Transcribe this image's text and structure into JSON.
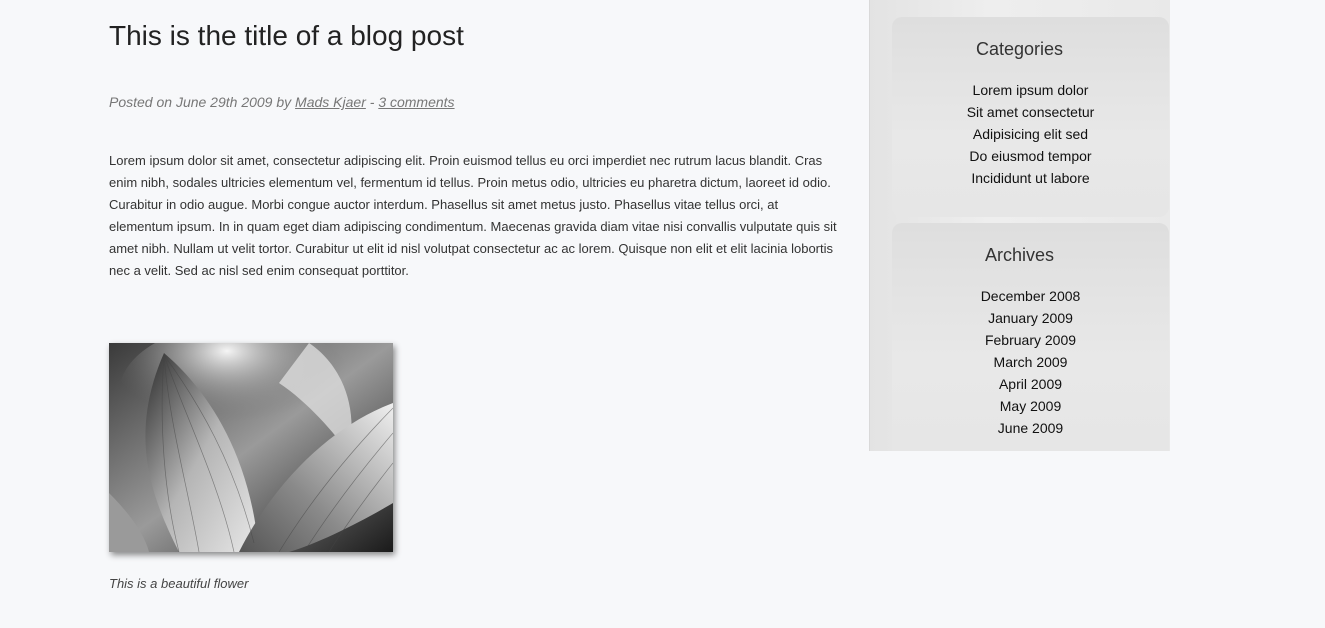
{
  "post": {
    "title": "This is the title of a blog post",
    "meta_prefix": "Posted on June 29th 2009 by",
    "author": "Mads Kjaer",
    "separator": "-",
    "comments": "3 comments",
    "body": "Lorem ipsum dolor sit amet, consectetur adipiscing elit. Proin euismod tellus eu orci imperdiet nec rutrum lacus blandit. Cras enim nibh, sodales ultricies elementum vel, fermentum id tellus. Proin metus odio, ultricies eu pharetra dictum, laoreet id odio. Curabitur in odio augue. Morbi congue auctor interdum. Phasellus sit amet metus justo. Phasellus vitae tellus orci, at elementum ipsum. In in quam eget diam adipiscing condimentum. Maecenas gravida diam vitae nisi convallis vulputate quis sit amet nibh. Nullam ut velit tortor. Curabitur ut elit id nisl volutpat consectetur ac ac lorem. Quisque non elit et elit lacinia lobortis nec a velit. Sed ac nisl sed enim consequat porttitor.",
    "caption": "This is a beautiful flower"
  },
  "sidebar": {
    "categories": {
      "title": "Categories",
      "items": [
        "Lorem ipsum dolor",
        "Sit amet consectetur",
        "Adipisicing elit sed",
        "Do eiusmod tempor",
        "Incididunt ut labore"
      ]
    },
    "archives": {
      "title": "Archives",
      "items": [
        "December 2008",
        "January 2009",
        "February 2009",
        "March 2009",
        "April 2009",
        "May 2009",
        "June 2009"
      ]
    }
  }
}
